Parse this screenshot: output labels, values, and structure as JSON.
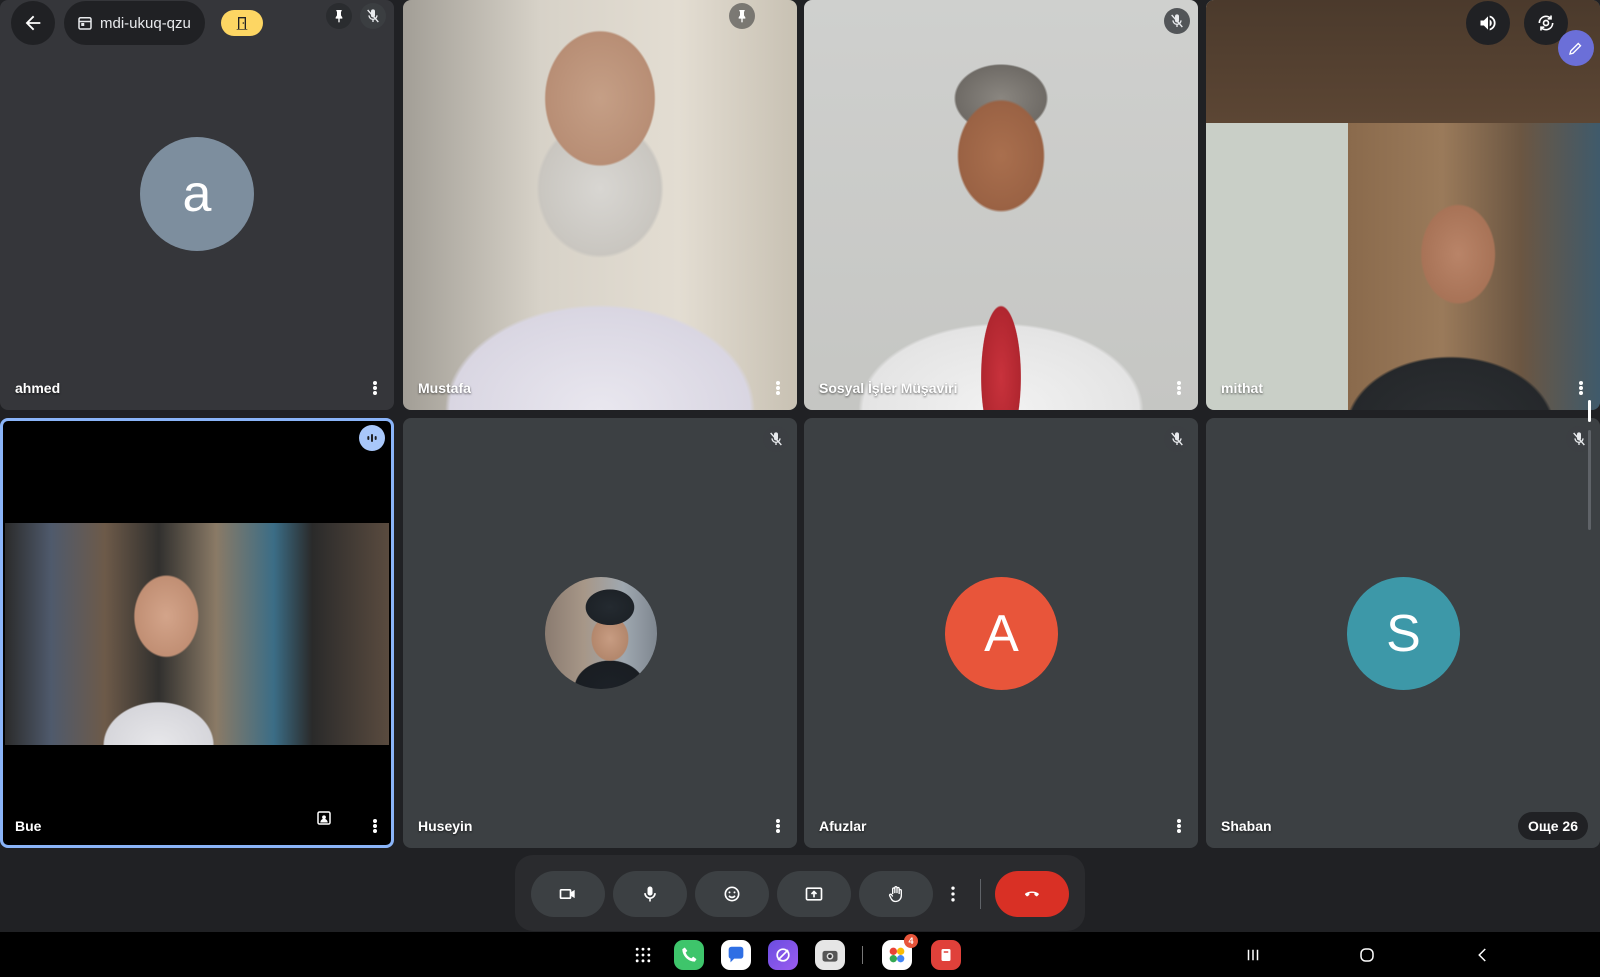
{
  "meeting": {
    "code": "mdi-ukuq-qzu",
    "others_label": "Още 26"
  },
  "participants": [
    {
      "name": "ahmed",
      "avatar_letter": "a",
      "avatar_color": "#7d8e9e"
    },
    {
      "name": "Mustafa"
    },
    {
      "name": "Sosyal İşler Müşaviri"
    },
    {
      "name": "mithat"
    },
    {
      "name": "Bue"
    },
    {
      "name": "Huseyin"
    },
    {
      "name": "Afuzlar",
      "avatar_letter": "A",
      "avatar_color": "#e8553a"
    },
    {
      "name": "Shaban",
      "avatar_letter": "S",
      "avatar_color": "#3d98a8"
    }
  ],
  "controls": {
    "icons": [
      "camera-icon",
      "microphone-icon",
      "emoji-icon",
      "present-screen-icon",
      "raise-hand-icon",
      "more-vert-icon",
      "end-call-icon"
    ],
    "end_color": "#d93025"
  },
  "taskbar": {
    "apps": [
      "app-drawer-icon",
      "phone-app-icon",
      "messages-app-icon",
      "internet-app-icon",
      "camera-app-icon",
      "photos-app-icon",
      "office-app-icon"
    ],
    "photos_badge": "4"
  },
  "colors": {
    "active_speaker_border": "#8ab4f8",
    "host_chip": "#fdd663",
    "tile_bg": "#3c4043"
  }
}
